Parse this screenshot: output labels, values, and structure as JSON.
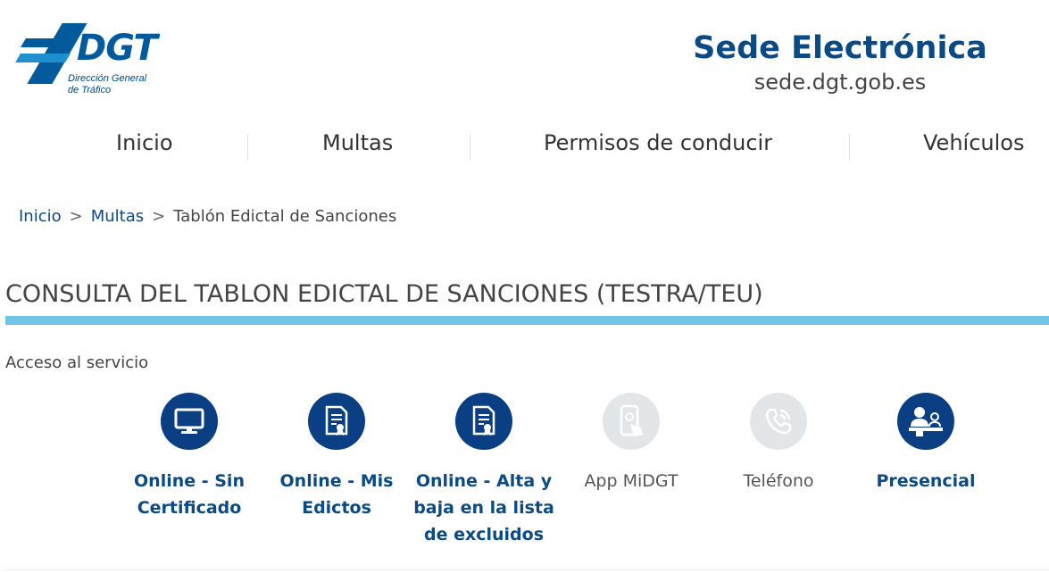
{
  "header": {
    "logo": {
      "text": "DGT",
      "subtitle_line1": "Dirección General",
      "subtitle_line2": "de Tráfico"
    },
    "sede_title": "Sede Electrónica",
    "sede_url": "sede.dgt.gob.es"
  },
  "nav": {
    "items": [
      {
        "label": "Inicio"
      },
      {
        "label": "Multas"
      },
      {
        "label": "Permisos de conducir"
      },
      {
        "label": "Vehículos"
      }
    ]
  },
  "breadcrumb": {
    "items": [
      {
        "label": "Inicio"
      },
      {
        "label": "Multas"
      }
    ],
    "separator": ">",
    "current": "Tablón Edictal de Sanciones"
  },
  "page": {
    "title": "CONSULTA DEL TABLON EDICTAL DE SANCIONES (TESTRA/TEU)",
    "section_label": "Acceso al servicio"
  },
  "services": [
    {
      "line1": "Online - Sin",
      "line2": "Certificado",
      "line3": "",
      "icon": "monitor-icon",
      "enabled": true
    },
    {
      "line1": "Online - Mis",
      "line2": "Edictos",
      "line3": "",
      "icon": "certificate-document-icon",
      "enabled": true
    },
    {
      "line1": "Online - Alta y",
      "line2": "baja en la lista",
      "line3": "de excluidos",
      "icon": "certificate-document-icon",
      "enabled": true
    },
    {
      "line1": "App MiDGT",
      "line2": "",
      "line3": "",
      "icon": "mobile-app-icon",
      "enabled": false
    },
    {
      "line1": "Teléfono",
      "line2": "",
      "line3": "",
      "icon": "phone-icon",
      "enabled": false
    },
    {
      "line1": "Presencial",
      "line2": "",
      "line3": "",
      "icon": "counter-attendance-icon",
      "enabled": true
    }
  ],
  "colors": {
    "brand_blue": "#005a9c",
    "link_blue": "#0b4a85",
    "accent_rule": "#72c4e4",
    "disabled_circle": "#e3e6e9"
  }
}
